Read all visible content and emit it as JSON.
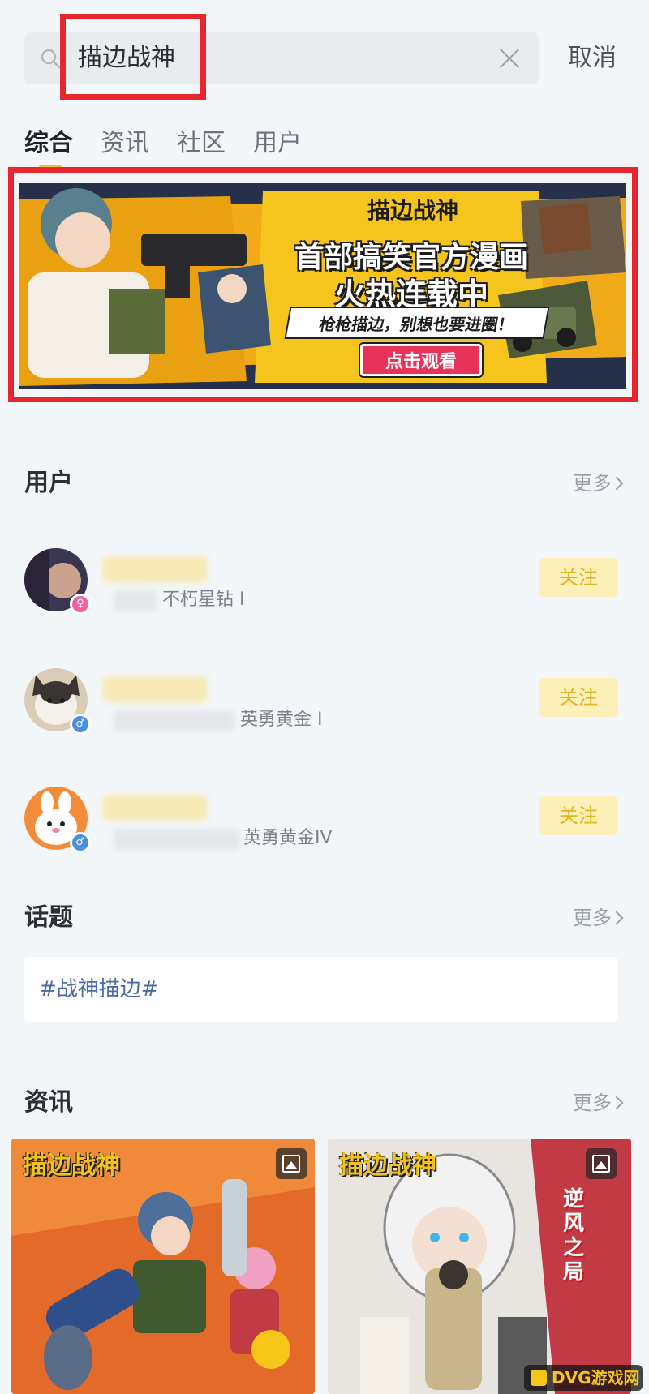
{
  "search": {
    "query": "描边战神",
    "cancel_label": "取消"
  },
  "tabs": [
    {
      "label": "综合",
      "active": true
    },
    {
      "label": "资讯",
      "active": false
    },
    {
      "label": "社区",
      "active": false
    },
    {
      "label": "用户",
      "active": false
    }
  ],
  "banner": {
    "logo": "描边战神",
    "headline_1": "首部搞笑官方漫画",
    "headline_2": "火热连载中",
    "slogan": "枪枪描边，别想也要进圈！",
    "cta": "点击观看"
  },
  "users_section": {
    "title": "用户",
    "more_label": "更多",
    "users": [
      {
        "rank": "不朽星钻 I",
        "gender": "female",
        "follow_label": "关注"
      },
      {
        "rank": "英勇黄金 I",
        "gender": "male",
        "follow_label": "关注"
      },
      {
        "rank": "英勇黄金IV",
        "gender": "male",
        "follow_label": "关注"
      }
    ]
  },
  "topics_section": {
    "title": "话题",
    "more_label": "更多",
    "topic": "#战神描边#"
  },
  "news_section": {
    "title": "资讯",
    "more_label": "更多",
    "cards": [
      {
        "logo": "描边战神"
      },
      {
        "logo": "描边战神",
        "side_text": "逆风之局"
      }
    ]
  },
  "watermark": "DVG游戏网",
  "colors": {
    "accent": "#f5c518",
    "highlight_border": "#e8262d",
    "follow_bg": "#fcefb7",
    "follow_text": "#e0b621",
    "topic_text": "#4a6aa8"
  }
}
